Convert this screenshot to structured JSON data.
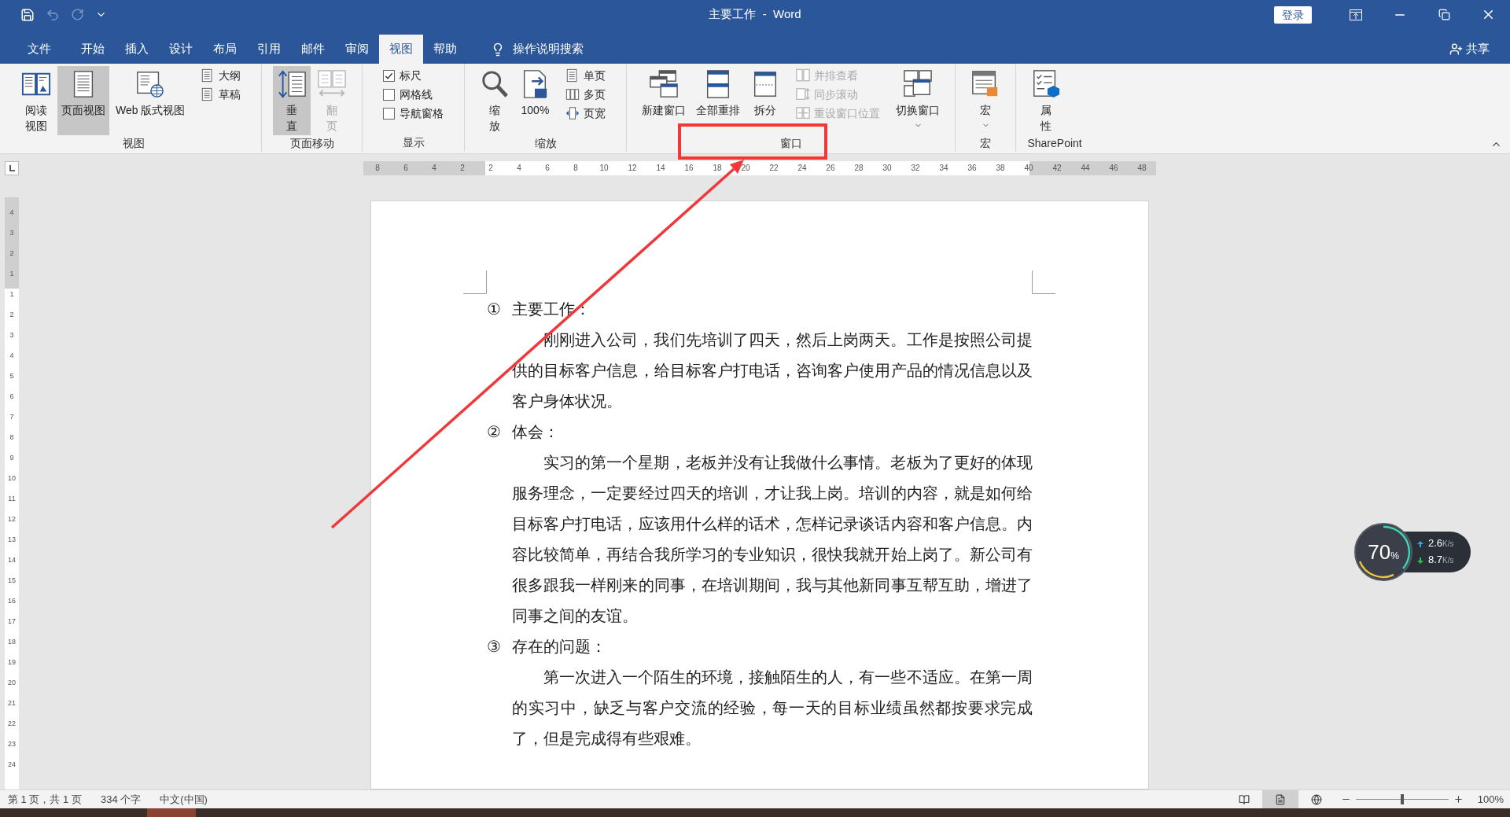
{
  "title_bar": {
    "title": "主要工作  -  Word",
    "login_button": "登录"
  },
  "menu_tabs": [
    {
      "label": "文件",
      "selected": false
    },
    {
      "label": "开始",
      "selected": false
    },
    {
      "label": "插入",
      "selected": false
    },
    {
      "label": "设计",
      "selected": false
    },
    {
      "label": "布局",
      "selected": false
    },
    {
      "label": "引用",
      "selected": false
    },
    {
      "label": "邮件",
      "selected": false
    },
    {
      "label": "审阅",
      "selected": false
    },
    {
      "label": "视图",
      "selected": true
    },
    {
      "label": "帮助",
      "selected": false
    }
  ],
  "tell_me": {
    "placeholder": "操作说明搜索"
  },
  "share_button": "共享",
  "ribbon_groups": [
    {
      "label": "视图",
      "items": [
        {
          "kind": "narrow",
          "label": "阅读视图",
          "selected": false,
          "disabled": false
        },
        {
          "kind": "large",
          "label": "页面视图",
          "selected": true,
          "disabled": false
        },
        {
          "kind": "large",
          "label": "Web 版式视图",
          "selected": false,
          "disabled": false
        },
        {
          "kind": "small",
          "label": "大纲",
          "selected": false,
          "disabled": false
        },
        {
          "kind": "small",
          "label": "草稿",
          "selected": false,
          "disabled": false
        }
      ]
    },
    {
      "label": "页面移动",
      "items": [
        {
          "kind": "column",
          "label": "垂直",
          "selected": true,
          "disabled": false
        },
        {
          "kind": "column",
          "label": "翻页",
          "selected": false,
          "disabled": true
        }
      ]
    },
    {
      "label": "显示",
      "items": [
        {
          "kind": "check",
          "label": "标尺",
          "checked": true
        },
        {
          "kind": "check",
          "label": "网格线",
          "checked": false
        },
        {
          "kind": "check",
          "label": "导航窗格",
          "checked": false
        }
      ]
    },
    {
      "label": "缩放",
      "items": [
        {
          "kind": "column",
          "label": "缩放",
          "disabled": false
        },
        {
          "kind": "large",
          "label": "100%",
          "disabled": false
        },
        {
          "kind": "small",
          "label": "单页",
          "disabled": false
        },
        {
          "kind": "small",
          "label": "多页",
          "disabled": false
        },
        {
          "kind": "small",
          "label": "页宽",
          "disabled": false
        }
      ]
    },
    {
      "label": "窗口",
      "items": [
        {
          "kind": "large",
          "label": "新建窗口",
          "disabled": false
        },
        {
          "kind": "large",
          "label": "全部重排",
          "disabled": false
        },
        {
          "kind": "large",
          "label": "拆分",
          "disabled": false
        },
        {
          "kind": "small",
          "label": "并排查看",
          "disabled": true
        },
        {
          "kind": "small",
          "label": "同步滚动",
          "disabled": true
        },
        {
          "kind": "small",
          "label": "重设窗口位置",
          "disabled": true
        },
        {
          "kind": "menu",
          "label": "切换窗口",
          "disabled": false
        }
      ]
    },
    {
      "label": "宏",
      "items": [
        {
          "kind": "menu",
          "label": "宏",
          "disabled": false
        }
      ]
    },
    {
      "label": "SharePoint",
      "items": [
        {
          "kind": "column",
          "label": "属性",
          "disabled": false
        }
      ]
    }
  ],
  "h_ruler_labels": [
    "8",
    "6",
    "4",
    "2",
    "2",
    "4",
    "6",
    "8",
    "10",
    "12",
    "14",
    "16",
    "18",
    "20",
    "22",
    "24",
    "26",
    "28",
    "30",
    "32",
    "34",
    "36",
    "38",
    "40",
    "42",
    "44",
    "46",
    "48"
  ],
  "v_ruler_labels": [
    "4",
    "3",
    "2",
    "1",
    "1",
    "2",
    "3",
    "4",
    "5",
    "6",
    "7",
    "8",
    "9",
    "10",
    "11",
    "12",
    "13",
    "14",
    "15",
    "16",
    "17",
    "18",
    "19",
    "20",
    "21",
    "22",
    "23",
    "24"
  ],
  "document": {
    "sections": [
      {
        "number": "①",
        "heading": "主要工作：",
        "paragraphs": [
          "刚刚进入公司，我们先培训了四天，然后上岗两天。工作是按照公司提供的目标客户信息，给目标客户打电话，咨询客户使用产品的情况信息以及客户身体状况。"
        ]
      },
      {
        "number": "②",
        "heading": "体会：",
        "paragraphs": [
          "实习的第一个星期，老板并没有让我做什么事情。老板为了更好的体现服务理念，一定要经过四天的培训，才让我上岗。培训的内容，就是如何给目标客户打电话，应该用什么样的话术，怎样记录谈话内容和客户信息。内容比较简单，再结合我所学习的专业知识，很快我就开始上岗了。新公司有很多跟我一样刚来的同事，在培训期间，我与其他新同事互帮互助，增进了同事之间的友谊。"
        ]
      },
      {
        "number": "③",
        "heading": "存在的问题：",
        "paragraphs": [
          "第一次进入一个陌生的环境，接触陌生的人，有一些不适应。在第一周的实习中，缺乏与客户交流的经验，每一天的目标业绩虽然都按要求完成了，但是完成得有些艰难。"
        ]
      }
    ]
  },
  "network_widget": {
    "percent": {
      "value": "70",
      "unit": "%"
    },
    "upload": {
      "value": "2.6",
      "unit": "K/s"
    },
    "download": {
      "value": "8.7",
      "unit": "K/s"
    }
  },
  "status_bar": {
    "page": "第 1 页，共 1 页",
    "words": "334 个字",
    "language": "中文(中国)",
    "views": [
      {
        "selected": false
      },
      {
        "selected": true
      },
      {
        "selected": false
      }
    ],
    "zoom": {
      "level": 0.5
    },
    "zoom_percent": "100%"
  }
}
